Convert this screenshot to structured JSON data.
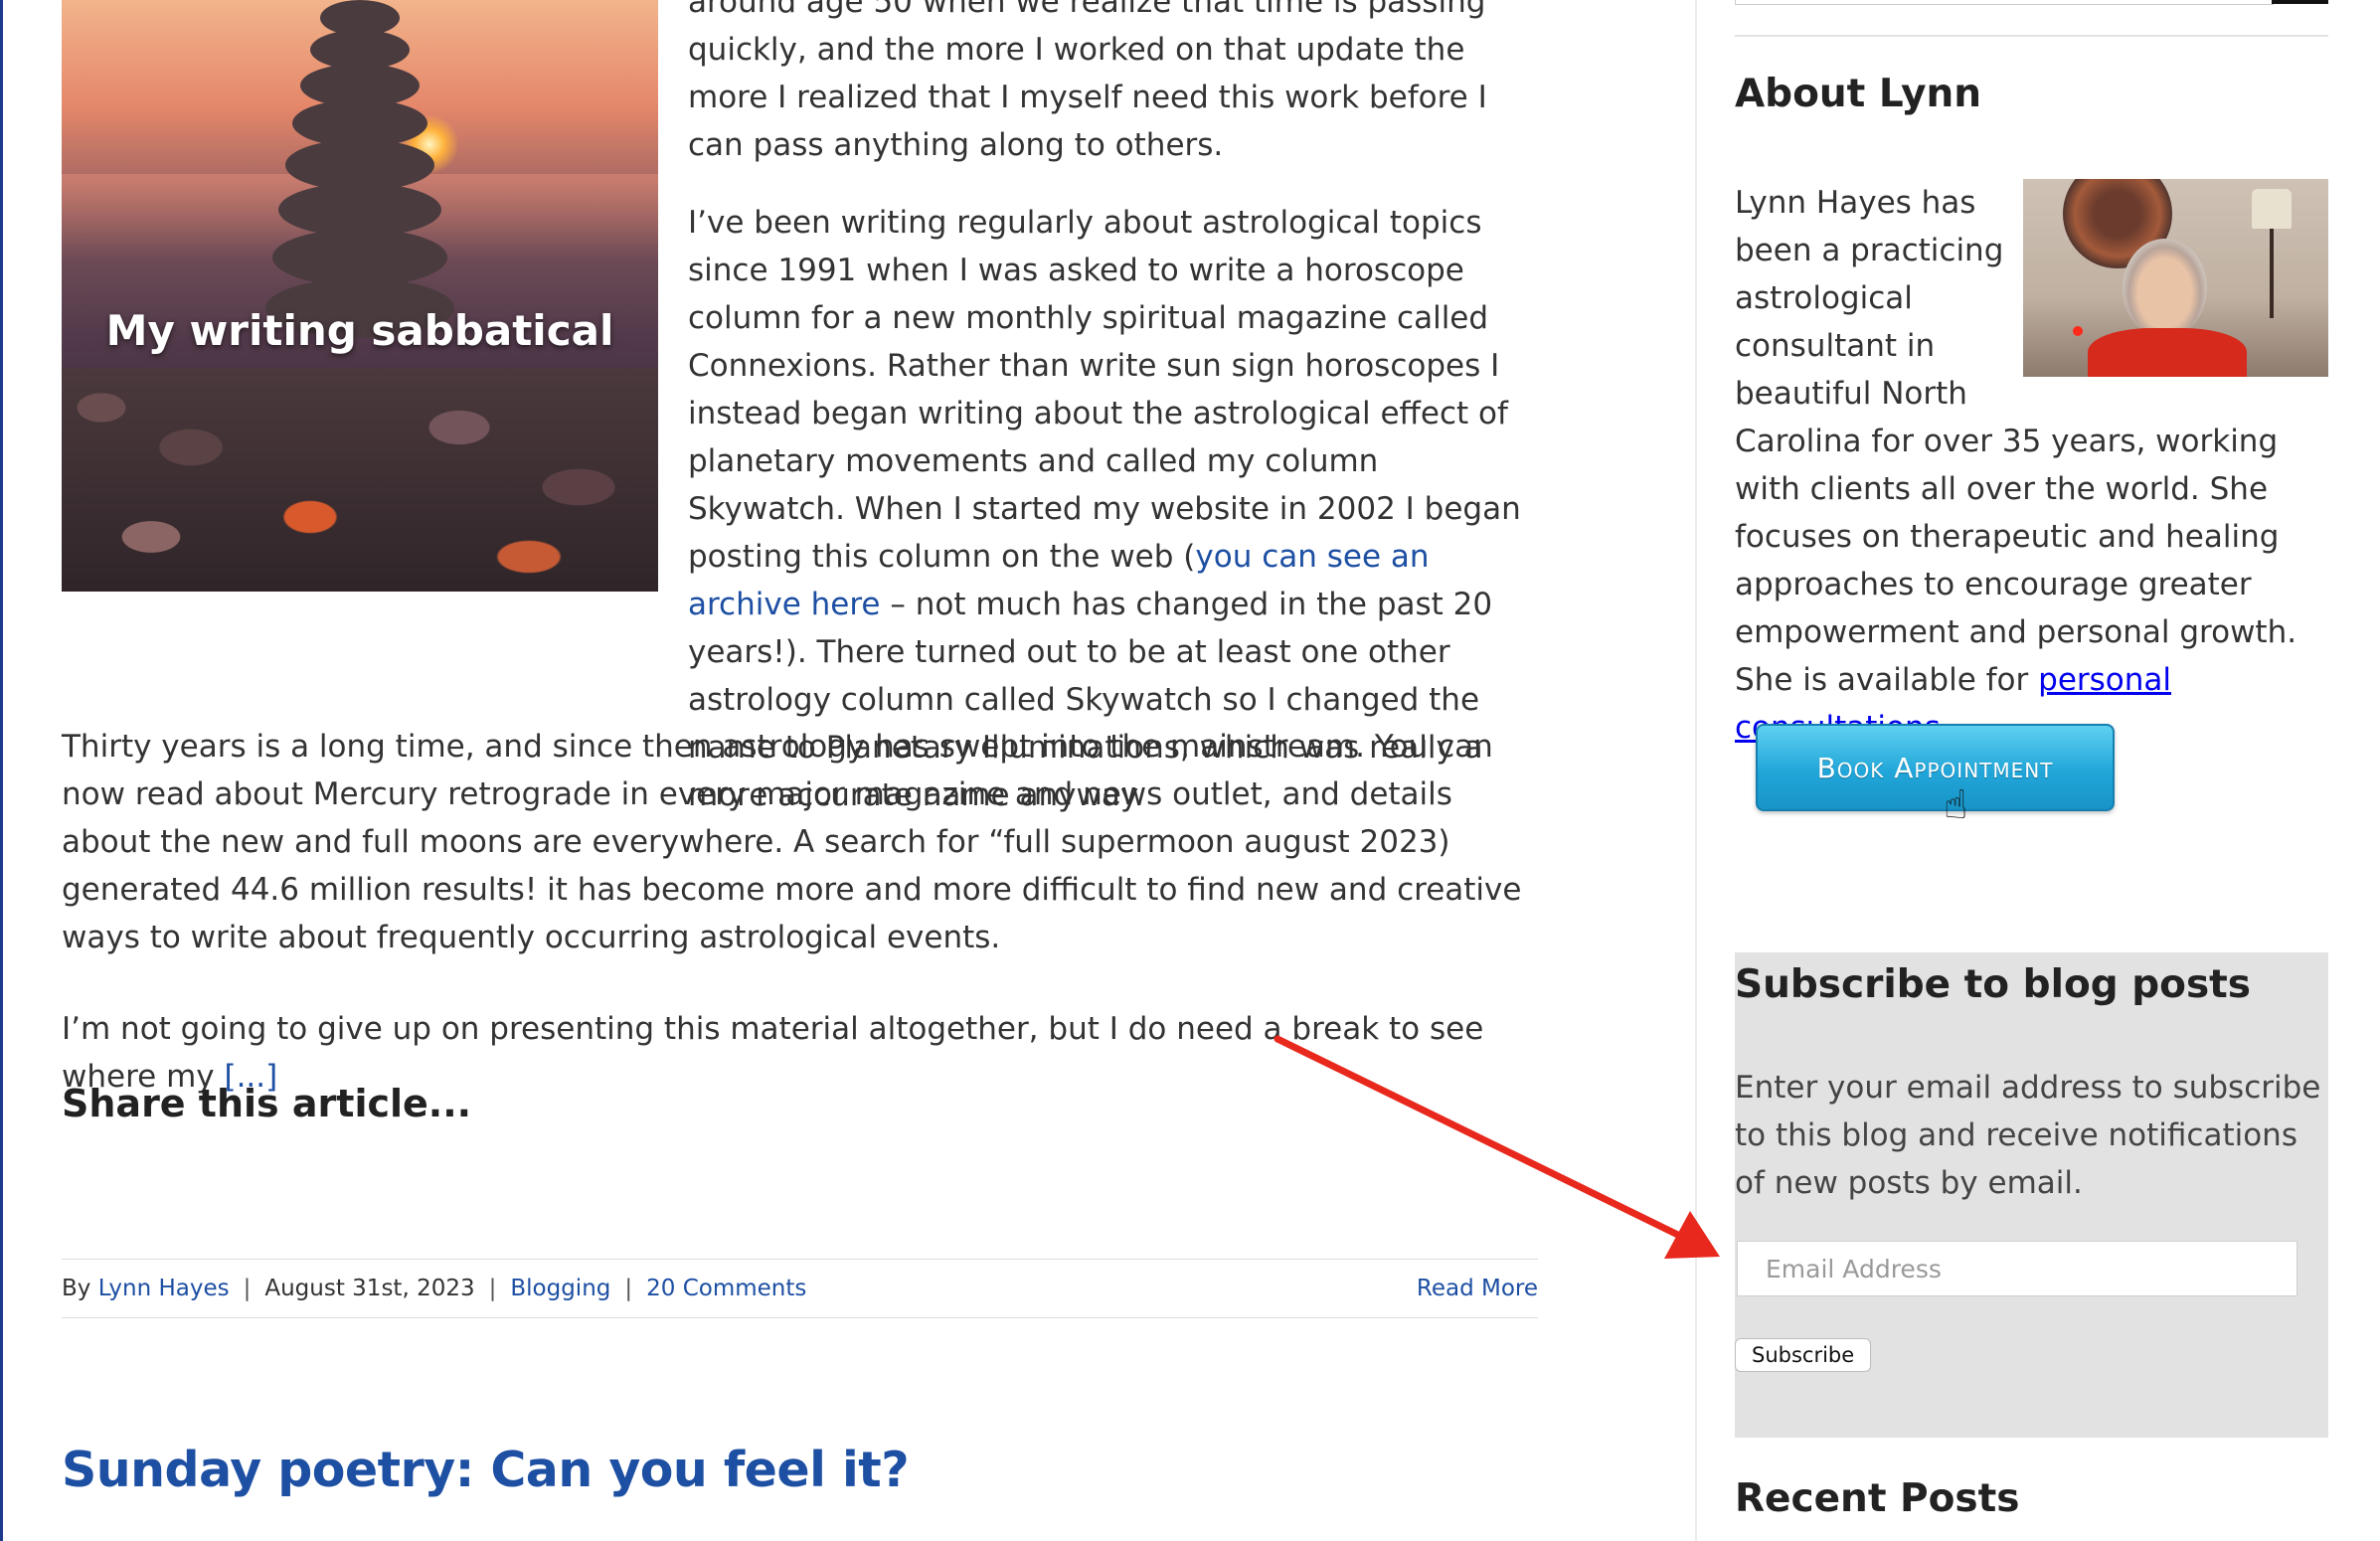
{
  "colors": {
    "link": "#1d4fa3",
    "annotation_arrow": "#e8281c",
    "subscribe_bg": "#e2e2e2",
    "button_blue": "#21a6d9"
  },
  "article": {
    "featured_image": {
      "caption": "My writing sabbatical"
    },
    "para_top": "around age 50 when we realize that time is passing quickly, and the more I worked on that update the more I realized that I myself need this work before I can pass anything along to others.",
    "para2_a": "I’ve been writing regularly about astrological topics since 1991 when I was asked to write a horoscope column for a new monthly spiritual magazine called Connexions. Rather than write sun sign horoscopes I instead began writing about the astrological effect of planetary movements and called my column Skywatch. When I started my website in 2002 I began posting this column on the web (",
    "para2_link": "you can see an archive here",
    "para2_b": " – not much has changed in the past 20 years!). There turned out to be at least one other astrology column called Skywatch so I changed the name to Planetary Illuminations, which was really a more accurate name anyway.",
    "para3": "Thirty years is a long time, and since then astrology has swept into the mainstream. You can now read about Mercury retrograde in every major magazine and news outlet, and details about the new and full moons are everywhere. A search for “full supermoon august 2023) generated 44.6 million results! it has become more and more difficult to find new and creative ways to write about frequently occurring astrological events.",
    "para4": "I’m not going to give up on presenting this material altogether, but I do need a break to see where my ",
    "para4_more": "[...]",
    "share_title": "Share this article...",
    "meta": {
      "by": "By",
      "author": "Lynn Hayes",
      "date": "August 31st, 2023",
      "category": "Blogging",
      "comments": "20 Comments",
      "read_more": "Read More",
      "separator": "|"
    }
  },
  "next_post": {
    "title": "Sunday poetry: Can you feel it?"
  },
  "sidebar": {
    "about": {
      "heading": "About Lynn",
      "text": "Lynn Hayes has been a practicing astrological consultant in beautiful North Carolina for over 35 years, working with clients all over the world. She focuses on therapeutic and healing approaches to encourage greater empowerment and personal growth. She is available for ",
      "link": "personal consultations",
      "end": ".",
      "button": "Book Appointment",
      "cursor_icon": "hand-pointer-icon"
    },
    "subscribe": {
      "heading": "Subscribe to blog posts",
      "text": "Enter your email address to subscribe to this blog and receive notifications of new posts by email.",
      "email_placeholder": "Email Address",
      "email_value": "",
      "button": "Subscribe"
    },
    "recent": {
      "heading": "Recent Posts"
    }
  },
  "annotation": {
    "icon": "red-arrow-icon"
  }
}
